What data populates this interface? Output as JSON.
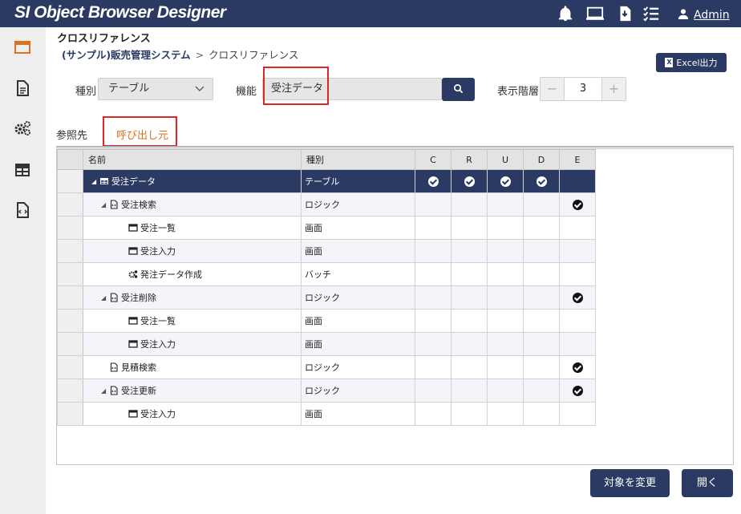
{
  "header": {
    "app_title": "SI Object Browser Designer",
    "icons": [
      "bell-icon",
      "monitor-icon",
      "download-icon",
      "checklist-icon"
    ],
    "user_label": "Admin"
  },
  "sidebar": {
    "items": [
      "window-icon",
      "document-icon",
      "gears-icon",
      "table-icon",
      "code-file-icon"
    ],
    "active_color": "#e07020"
  },
  "page": {
    "title": "クロスリファレンス",
    "breadcrumb": {
      "link": "(サンプル)販売管理システム",
      "separator": ">",
      "current": "クロスリファレンス"
    },
    "excel_button": "Excel出力"
  },
  "filters": {
    "kind_label": "種別",
    "kind_value": "テーブル",
    "func_label": "機能",
    "func_value": "受注データ",
    "level_label": "表示階層",
    "level_value": "3",
    "minus": "−",
    "plus": "+"
  },
  "tabs": {
    "reference": "参照先",
    "caller": "呼び出し元"
  },
  "grid": {
    "headers": {
      "name": "名前",
      "kind": "種別",
      "c": "C",
      "r": "R",
      "u": "U",
      "d": "D",
      "e": "E"
    },
    "rows": [
      {
        "name": "受注データ",
        "kind": "テーブル",
        "icon": "table-icon",
        "level": 0,
        "expand": true,
        "c": true,
        "r": true,
        "u": true,
        "d": true,
        "e": false
      },
      {
        "name": "受注検索",
        "kind": "ロジック",
        "icon": "code-file-icon",
        "level": 1,
        "expand": true,
        "e": true
      },
      {
        "name": "受注一覧",
        "kind": "画面",
        "icon": "window-icon",
        "level": 2
      },
      {
        "name": "受注入力",
        "kind": "画面",
        "icon": "window-icon",
        "level": 2
      },
      {
        "name": "発注データ作成",
        "kind": "バッチ",
        "icon": "gears-icon",
        "level": 2
      },
      {
        "name": "受注削除",
        "kind": "ロジック",
        "icon": "code-file-icon",
        "level": 1,
        "expand": true,
        "e": true
      },
      {
        "name": "受注一覧",
        "kind": "画面",
        "icon": "window-icon",
        "level": 2
      },
      {
        "name": "受注入力",
        "kind": "画面",
        "icon": "window-icon",
        "level": 2
      },
      {
        "name": "見積検索",
        "kind": "ロジック",
        "icon": "code-file-icon",
        "level": 1,
        "expand": false,
        "e": true
      },
      {
        "name": "受注更新",
        "kind": "ロジック",
        "icon": "code-file-icon",
        "level": 1,
        "expand": true,
        "e": true
      },
      {
        "name": "受注入力",
        "kind": "画面",
        "icon": "window-icon",
        "level": 2
      }
    ]
  },
  "actions": {
    "change_target": "対象を変更",
    "open": "開く"
  },
  "colors": {
    "primary": "#2a3a62",
    "highlight_box": "#e02424",
    "tab_active": "#e07020"
  }
}
